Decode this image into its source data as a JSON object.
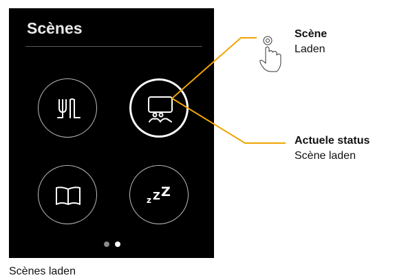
{
  "device": {
    "title": "Scènes",
    "buttons": [
      {
        "icon": "dining-icon"
      },
      {
        "icon": "presentation-icon",
        "state": "active"
      },
      {
        "icon": "book-icon"
      },
      {
        "icon": "sleep-icon",
        "glyph": "zZZ"
      }
    ],
    "page_indicator": {
      "total": 2,
      "current": 2
    }
  },
  "callouts": {
    "scene": {
      "title": "Scène",
      "subtitle": "Laden"
    },
    "status": {
      "title": "Actuele status",
      "subtitle": "Scène laden"
    }
  },
  "caption": "Scènes laden",
  "colors": {
    "accent": "#f0a500",
    "device_bg": "#000000",
    "active_border": "#ffffff",
    "inactive_border": "#bdbdbd"
  }
}
